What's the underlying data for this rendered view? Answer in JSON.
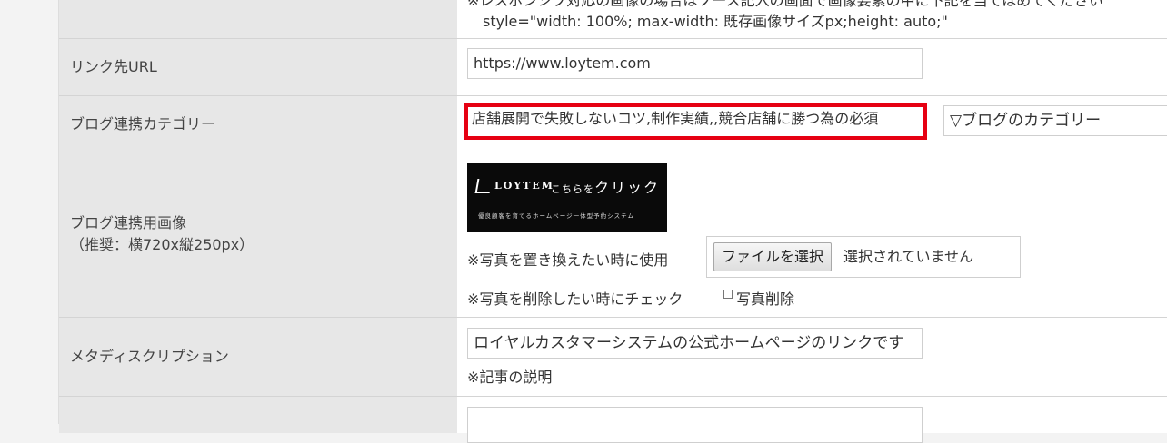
{
  "rows": {
    "top": {
      "partial_note": "※レスポンシブ対応の画像の場合はソース記入の画面で画像要素の中に下記を当てはめてください",
      "style_code": "style=\"width: 100%; max-width: 既存画像サイズpx;height: auto;\""
    },
    "link_url": {
      "label": "リンク先URL",
      "value": "https://www.loytem.com"
    },
    "blog_category": {
      "label": "ブログ連携カテゴリー",
      "value": "店舗展開で失敗しないコツ,制作実績,,競合店舗に勝つ為の必須",
      "select_label": "▽ブログのカテゴリー"
    },
    "blog_image": {
      "label_line1": "ブログ連携用画像",
      "label_line2": "（推奨：横720x縦250px）",
      "banner": {
        "logo_text": "LOYTEM",
        "cta_small": "こちらを",
        "cta_large": "クリック",
        "tagline": "優良顧客を育てるホームページ一体型予約システム"
      },
      "replace_note": "※写真を置き換えたい時に使用",
      "file_button_label": "ファイルを選択",
      "file_status": "選択されていません",
      "delete_note": "※写真を削除したい時にチェック",
      "delete_checkbox_label": "写真削除"
    },
    "meta_description": {
      "label": "メタディスクリプション",
      "value": "ロイヤルカスタマーシステムの公式ホームページのリンクです",
      "note": "※記事の説明"
    }
  },
  "colors": {
    "highlight": "#e60012",
    "header_cell": "#e7e7e7",
    "page_bg": "#f3f3f3"
  }
}
